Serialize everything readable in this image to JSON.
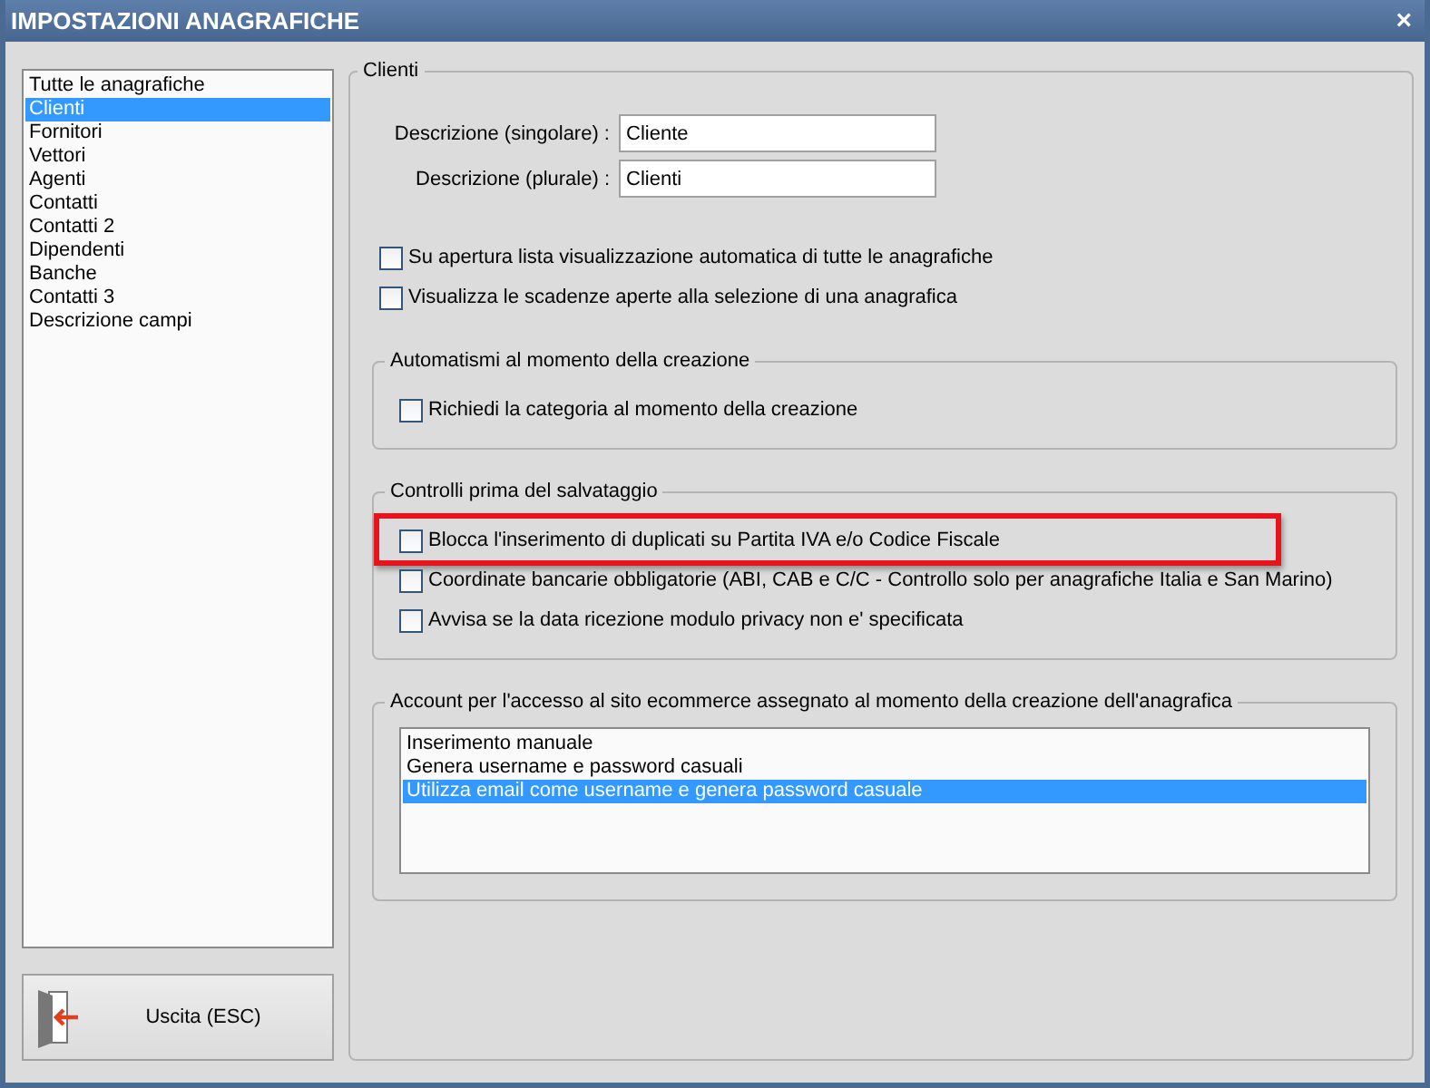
{
  "window": {
    "title": "IMPOSTAZIONI ANAGRAFICHE",
    "close": "×"
  },
  "sidebar": {
    "items": [
      {
        "label": "Tutte le anagrafiche",
        "selected": false
      },
      {
        "label": "Clienti",
        "selected": true
      },
      {
        "label": "Fornitori",
        "selected": false
      },
      {
        "label": "Vettori",
        "selected": false
      },
      {
        "label": "Agenti",
        "selected": false
      },
      {
        "label": "Contatti",
        "selected": false
      },
      {
        "label": "Contatti 2",
        "selected": false
      },
      {
        "label": "Dipendenti",
        "selected": false
      },
      {
        "label": "Banche",
        "selected": false
      },
      {
        "label": "Contatti 3",
        "selected": false
      },
      {
        "label": "Descrizione campi",
        "selected": false
      }
    ]
  },
  "exit_button": {
    "label": "Uscita (ESC)"
  },
  "panel": {
    "title": "Clienti",
    "fields": [
      {
        "label": "Descrizione (singolare) :",
        "value": "Cliente"
      },
      {
        "label": "Descrizione (plurale) :",
        "value": "Clienti"
      }
    ],
    "options": [
      {
        "label": "Su apertura lista visualizzazione automatica di tutte le anagrafiche",
        "checked": false,
        "highlighted": false
      },
      {
        "label": "Visualizza le scadenze aperte alla selezione di una anagrafica",
        "checked": false,
        "highlighted": false
      }
    ],
    "groups": [
      {
        "kind": "checks",
        "title": "Automatismi al momento della creazione",
        "options": [
          {
            "label": "Richiedi la categoria al momento della creazione",
            "checked": false,
            "highlighted": false
          }
        ]
      },
      {
        "kind": "checks",
        "title": "Controlli prima del salvataggio",
        "options": [
          {
            "label": "Blocca l'inserimento di duplicati su Partita IVA e/o Codice Fiscale",
            "checked": false,
            "highlighted": true
          },
          {
            "label": "Coordinate bancarie obbligatorie (ABI, CAB e C/C - Controllo solo per anagrafiche Italia e San Marino)",
            "checked": false,
            "highlighted": false
          },
          {
            "label": "Avvisa se la data ricezione modulo privacy non e' specificata",
            "checked": false,
            "highlighted": false
          }
        ]
      },
      {
        "kind": "list",
        "title": "Account per l'accesso al sito ecommerce assegnato al momento della creazione dell'anagrafica",
        "items": [
          {
            "label": "Inserimento manuale",
            "selected": false
          },
          {
            "label": "Genera username e password casuali",
            "selected": false
          },
          {
            "label": "Utilizza email come username e genera password casuale",
            "selected": true
          }
        ]
      }
    ]
  }
}
